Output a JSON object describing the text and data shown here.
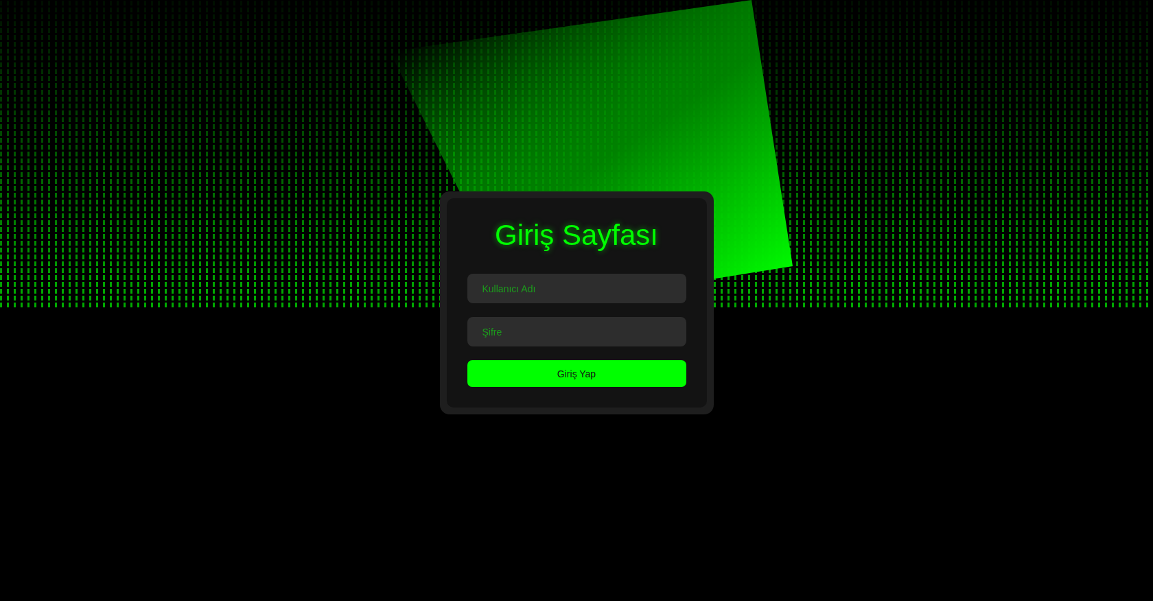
{
  "login_card": {
    "title": "Giriş Sayfası",
    "fields": [
      {
        "placeholder": "Kullanıcı Adı"
      },
      {
        "placeholder": "Şifre"
      }
    ],
    "submit_button": "Giriş Yap"
  }
}
